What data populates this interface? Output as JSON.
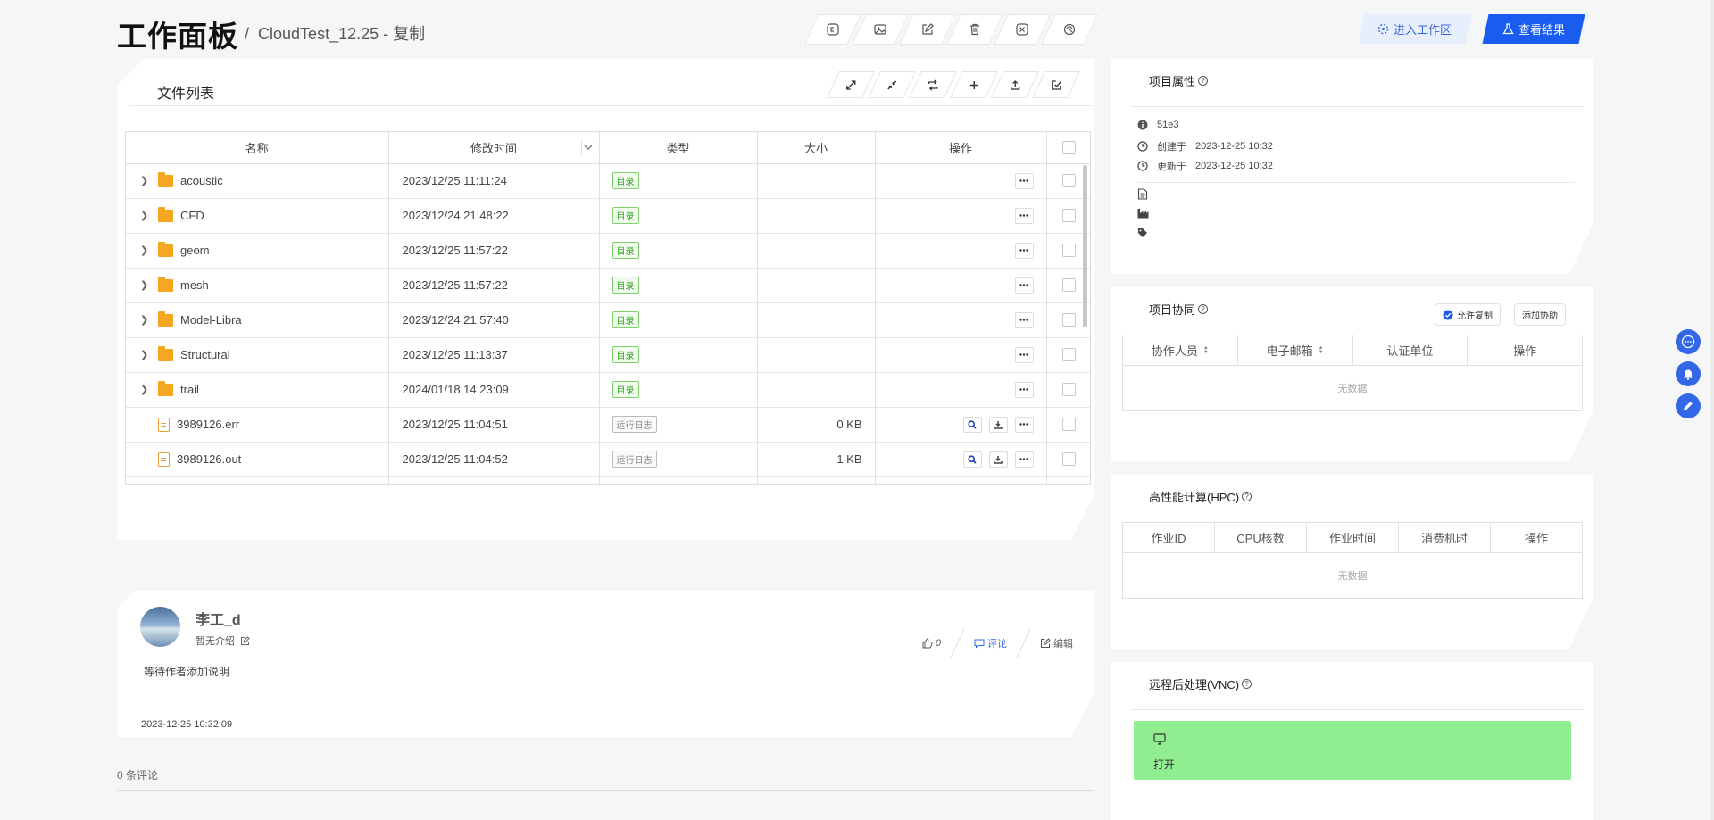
{
  "header": {
    "title": "工作面板",
    "breadcrumb_sep": "/",
    "breadcrumb": "CloudTest_12.25 - 复制",
    "toolbar_icons": [
      "copy-icon",
      "image-icon",
      "edit-icon",
      "delete-icon",
      "close-icon",
      "share-icon"
    ],
    "enter_workspace": "进入工作区",
    "view_results": "查看结果"
  },
  "files": {
    "title": "文件列表",
    "toolbar_icons": [
      "expand-icon",
      "collapse-icon",
      "refresh-icon",
      "add-icon",
      "upload-icon",
      "select-icon"
    ],
    "columns": [
      "名称",
      "修改时间",
      "类型",
      "大小",
      "操作"
    ],
    "rows": [
      {
        "name": "acoustic",
        "time": "2023/12/25 11:11:24",
        "type": "目录",
        "size": "",
        "kind": "folder"
      },
      {
        "name": "CFD",
        "time": "2023/12/24 21:48:22",
        "type": "目录",
        "size": "",
        "kind": "folder"
      },
      {
        "name": "geom",
        "time": "2023/12/25 11:57:22",
        "type": "目录",
        "size": "",
        "kind": "folder"
      },
      {
        "name": "mesh",
        "time": "2023/12/25 11:57:22",
        "type": "目录",
        "size": "",
        "kind": "folder"
      },
      {
        "name": "Model-Libra",
        "time": "2023/12/24 21:57:40",
        "type": "目录",
        "size": "",
        "kind": "folder"
      },
      {
        "name": "Structural",
        "time": "2023/12/25 11:13:37",
        "type": "目录",
        "size": "",
        "kind": "folder"
      },
      {
        "name": "trail",
        "time": "2024/01/18 14:23:09",
        "type": "目录",
        "size": "",
        "kind": "folder"
      },
      {
        "name": "3989126.err",
        "time": "2023/12/25 11:04:51",
        "type": "运行日志",
        "size": "0 KB",
        "kind": "file"
      },
      {
        "name": "3989126.out",
        "time": "2023/12/25 11:04:52",
        "type": "运行日志",
        "size": "1 KB",
        "kind": "file"
      }
    ]
  },
  "author": {
    "name": "李工_d",
    "intro": "暂无介绍",
    "description": "等待作者添加说明",
    "date": "2023-12-25 10:32:09",
    "likes": "0",
    "comment_label": "评论",
    "edit_label": "编辑"
  },
  "comments": {
    "count_label": "0 条评论"
  },
  "project_props": {
    "title": "项目属性",
    "id": "51e3",
    "created_label": "创建于",
    "created": "2023-12-25 10:32",
    "updated_label": "更新于",
    "updated": "2023-12-25 10:32"
  },
  "collab": {
    "title": "项目协同",
    "allow_copy": "允许复制",
    "add_collab": "添加协助",
    "columns": [
      "协作人员",
      "电子邮箱",
      "认证单位",
      "操作"
    ],
    "empty": "无数据"
  },
  "hpc": {
    "title": "高性能计算(HPC)",
    "columns": [
      "作业ID",
      "CPU核数",
      "作业时间",
      "消费机时",
      "操作"
    ],
    "empty": "无数据"
  },
  "vnc": {
    "title": "远程后处理(VNC)",
    "open_label": "打开"
  },
  "colors": {
    "primary": "#1a5cf0",
    "vnc_bg": "#90ee90",
    "folder": "#f5a623",
    "tag_green": "#37a32a"
  }
}
